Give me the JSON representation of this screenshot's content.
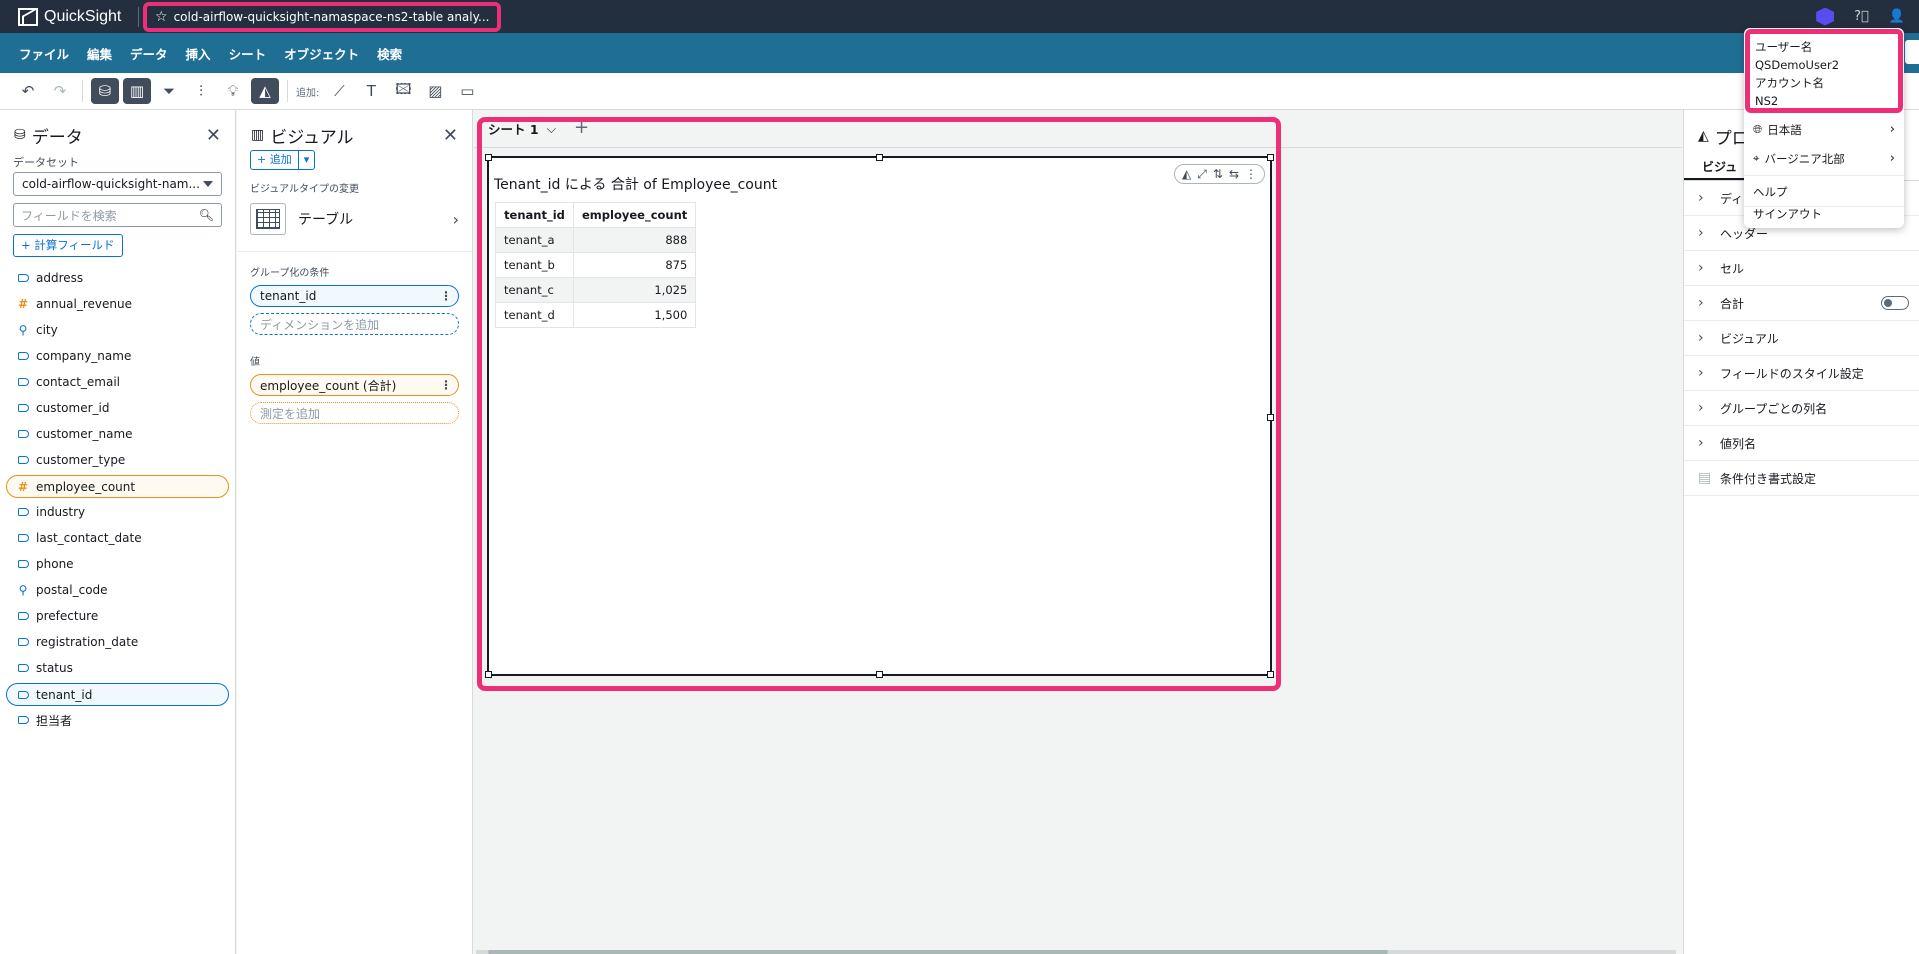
{
  "app": {
    "name": "QuickSight",
    "analysis_title": "cold-airflow-quicksight-namaspace-ns2-table analy..."
  },
  "menu": [
    "ファイル",
    "編集",
    "データ",
    "挿入",
    "シート",
    "オブジェクト",
    "検索"
  ],
  "toolbar": {
    "add_label": "追加:"
  },
  "data_panel": {
    "title": "データ",
    "dataset_label": "データセット",
    "dataset_value": "cold-airflow-quicksight-nam...",
    "search_placeholder": "フィールドを検索",
    "calc_field_label": "+ 計算フィールド",
    "fields": [
      {
        "name": "address",
        "type": "dim"
      },
      {
        "name": "annual_revenue",
        "type": "meas"
      },
      {
        "name": "city",
        "type": "geo"
      },
      {
        "name": "company_name",
        "type": "dim"
      },
      {
        "name": "contact_email",
        "type": "dim"
      },
      {
        "name": "customer_id",
        "type": "dim"
      },
      {
        "name": "customer_name",
        "type": "dim"
      },
      {
        "name": "customer_type",
        "type": "dim"
      },
      {
        "name": "employee_count",
        "type": "meas",
        "selected": true
      },
      {
        "name": "industry",
        "type": "dim"
      },
      {
        "name": "last_contact_date",
        "type": "dim"
      },
      {
        "name": "phone",
        "type": "dim"
      },
      {
        "name": "postal_code",
        "type": "geo"
      },
      {
        "name": "prefecture",
        "type": "dim"
      },
      {
        "name": "registration_date",
        "type": "dim"
      },
      {
        "name": "status",
        "type": "dim"
      },
      {
        "name": "tenant_id",
        "type": "dim",
        "selected": true
      },
      {
        "name": "担当者",
        "type": "dim"
      }
    ]
  },
  "visual_panel": {
    "title": "ビジュアル",
    "add_label": "+ 追加",
    "visual_type_label": "ビジュアルタイプの変更",
    "visual_type_name": "テーブル",
    "group_by_label": "グループ化の条件",
    "group_by_field": "tenant_id",
    "add_dimension_placeholder": "ディメンションを追加",
    "values_label": "値",
    "value_field": "employee_count (合計)",
    "add_measure_placeholder": "測定を追加"
  },
  "sheet": {
    "tab_label": "シート 1",
    "visual_title": "Tenant_id による 合計 of Employee_count",
    "table": {
      "headers": [
        "tenant_id",
        "employee_count"
      ],
      "rows": [
        [
          "tenant_a",
          "888"
        ],
        [
          "tenant_b",
          "875"
        ],
        [
          "tenant_c",
          "1,025"
        ],
        [
          "tenant_d",
          "1,500"
        ]
      ]
    }
  },
  "props_panel": {
    "title": "プロ",
    "tab_label": "ビジュ",
    "sections": [
      "ディ",
      "ヘッダー",
      "セル",
      "合計",
      "ビジュアル",
      "フィールドのスタイル設定",
      "グループごとの列名",
      "値列名",
      "条件付き書式設定"
    ]
  },
  "account_menu": {
    "username_label": "ユーザー名",
    "username": "QSDemoUser2",
    "account_label": "アカウント名",
    "account": "NS2",
    "language": "日本語",
    "region": "バージニア北部",
    "help": "ヘルプ",
    "signout": "サインアウト"
  },
  "colors": {
    "accent_pink": "#ee2f78",
    "menubar": "#1f6f95",
    "topbar": "#232f3e",
    "dimension": "#0972d3",
    "measure": "#e8901c"
  }
}
